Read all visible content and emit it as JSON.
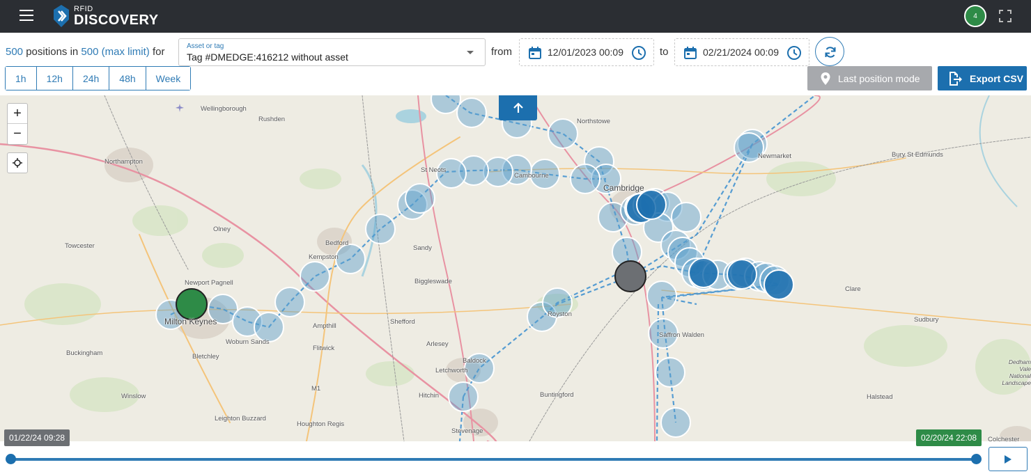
{
  "app": {
    "logo_small": "RFID",
    "logo_big": "DISCOVERY",
    "notification_count": "4"
  },
  "summary": {
    "count": "500",
    "text1": "positions in",
    "limit": "500 (max limit)",
    "text2": "for"
  },
  "asset": {
    "label": "Asset or tag",
    "value": "Tag #DMEDGE:416212 without asset"
  },
  "dates": {
    "from_label": "from",
    "from_value": "12/01/2023 00:09",
    "to_label": "to",
    "to_value": "02/21/2024 00:09"
  },
  "ranges": [
    "1h",
    "12h",
    "24h",
    "48h",
    "Week"
  ],
  "buttons": {
    "last_position": "Last position mode",
    "export": "Export CSV"
  },
  "map": {
    "places": [
      {
        "name": "Wellingborough",
        "cls": "place"
      },
      {
        "name": "Rushden",
        "cls": "place"
      },
      {
        "name": "Northampton",
        "cls": "place"
      },
      {
        "name": "Olney",
        "cls": "place"
      },
      {
        "name": "Towcester",
        "cls": "place"
      },
      {
        "name": "Newport Pagnell",
        "cls": "place"
      },
      {
        "name": "Milton Keynes",
        "cls": "place city"
      },
      {
        "name": "Woburn Sands",
        "cls": "place"
      },
      {
        "name": "Bletchley",
        "cls": "place"
      },
      {
        "name": "Buckingham",
        "cls": "place"
      },
      {
        "name": "Winslow",
        "cls": "place"
      },
      {
        "name": "Leighton Buzzard",
        "cls": "place"
      },
      {
        "name": "Houghton Regis",
        "cls": "place"
      },
      {
        "name": "Bedford",
        "cls": "place"
      },
      {
        "name": "Kempston",
        "cls": "place"
      },
      {
        "name": "Ampthill",
        "cls": "place"
      },
      {
        "name": "Flitwick",
        "cls": "place"
      },
      {
        "name": "Shefford",
        "cls": "place"
      },
      {
        "name": "Sandy",
        "cls": "place"
      },
      {
        "name": "Biggleswade",
        "cls": "place"
      },
      {
        "name": "Arlesey",
        "cls": "place"
      },
      {
        "name": "Baldock",
        "cls": "place"
      },
      {
        "name": "Letchworth",
        "cls": "place"
      },
      {
        "name": "Hitchin",
        "cls": "place"
      },
      {
        "name": "Stevenage",
        "cls": "place"
      },
      {
        "name": "St Neots",
        "cls": "place"
      },
      {
        "name": "Cambourne",
        "cls": "place"
      },
      {
        "name": "Northstowe",
        "cls": "place"
      },
      {
        "name": "Cambridge",
        "cls": "place city"
      },
      {
        "name": "Royston",
        "cls": "place"
      },
      {
        "name": "Buntingford",
        "cls": "place"
      },
      {
        "name": "Saffron Walden",
        "cls": "place"
      },
      {
        "name": "Newmarket",
        "cls": "place"
      },
      {
        "name": "Bury St Edmunds",
        "cls": "place"
      },
      {
        "name": "Clare",
        "cls": "place"
      },
      {
        "name": "Sudbury",
        "cls": "place"
      },
      {
        "name": "Halstead",
        "cls": "place"
      },
      {
        "name": "Colchester",
        "cls": "place"
      },
      {
        "name": "Dedham Vale National Landscape",
        "cls": "place"
      },
      {
        "name": "M1",
        "cls": "place"
      }
    ]
  },
  "timeline": {
    "start": "01/22/24 09:28",
    "end": "02/20/24 22:08",
    "position": 1.0
  },
  "colors": {
    "accent": "#1c6fae",
    "start_marker": "#2e8b47",
    "end_marker": "#6c6f73"
  }
}
